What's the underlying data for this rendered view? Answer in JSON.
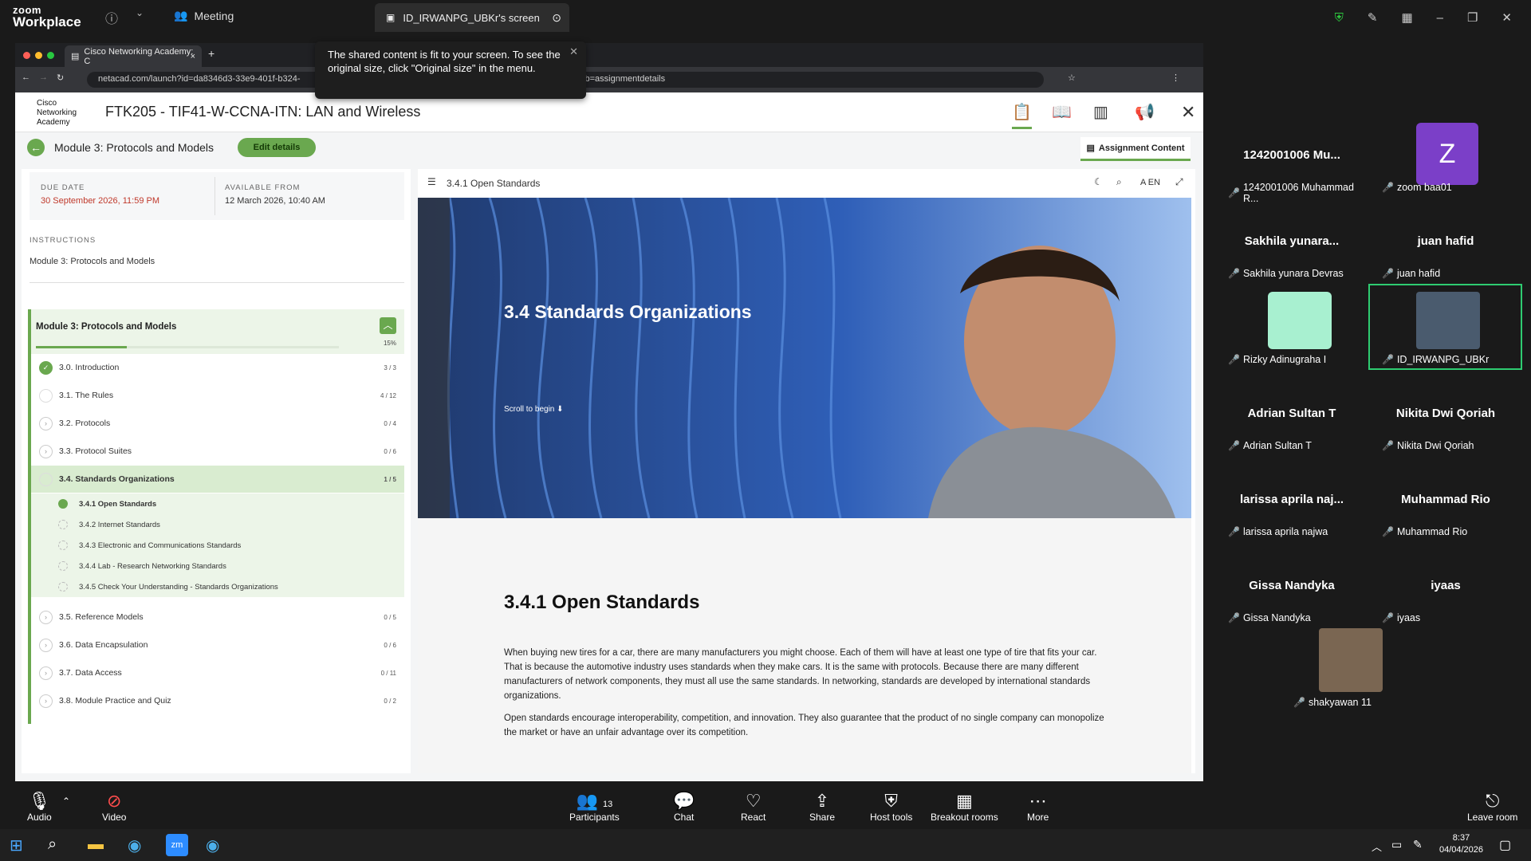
{
  "zoom": {
    "logo_line1": "zoom",
    "logo_line2": "Workplace",
    "meeting_label": "Meeting",
    "screen_tab_label": "ID_IRWANPG_UBKr's screen"
  },
  "toast": {
    "message": "The shared content is fit to your screen. To see the original size, click \"Original size\" in the menu."
  },
  "browser": {
    "tab_title": "Cisco Networking Academy: C",
    "url_left": "netacad.com/launch?id=da8346d3-33e9-401f-b324-",
    "url_right": "8-0dd8e67eee16&activeTab=assignmentdetails"
  },
  "app": {
    "logo_text": "Cisco Networking Academy",
    "course_title": "FTK205 - TIF41-W-CCNA-ITN: LAN and Wireless",
    "module_title": "Module 3: Protocols and Models",
    "edit_button": "Edit details",
    "assignment_tab": "Assignment Content"
  },
  "details": {
    "due_label": "DUE DATE",
    "due_value": "30 September 2026, 11:59 PM",
    "available_label": "AVAILABLE FROM",
    "available_value": "12 March 2026, 10:40 AM",
    "instructions_label": "INSTRUCTIONS",
    "instructions_value": "Module 3: Protocols and Models"
  },
  "module": {
    "title": "Module 3: Protocols and Models",
    "progress_text": "15%",
    "progress": 0.15,
    "items": [
      {
        "label": "3.0. Introduction",
        "count": "3 / 3"
      },
      {
        "label": "3.1. The Rules",
        "count": "4 / 12"
      },
      {
        "label": "3.2. Protocols",
        "count": "0 / 4"
      },
      {
        "label": "3.3. Protocol Suites",
        "count": "0 / 6"
      },
      {
        "label": "3.4. Standards Organizations",
        "count": "1 / 5"
      }
    ],
    "subitems": [
      "3.4.1 Open Standards",
      "3.4.2 Internet Standards",
      "3.4.3 Electronic and Communications Standards",
      "3.4.4 Lab - Research Networking Standards",
      "3.4.5 Check Your Understanding - Standards Organizations"
    ],
    "items_after": [
      {
        "label": "3.5. Reference Models",
        "count": "0 / 5"
      },
      {
        "label": "3.6. Data Encapsulation",
        "count": "0 / 6"
      },
      {
        "label": "3.7. Data Access",
        "count": "0 / 11"
      },
      {
        "label": "3.8. Module Practice and Quiz",
        "count": "0 / 2"
      }
    ]
  },
  "content": {
    "breadcrumb": "3.4.1 Open Standards",
    "lang": "EN",
    "hero_title": "3.4 Standards Organizations",
    "scroll_text": "Scroll to begin",
    "section_title": "3.4.1 Open Standards",
    "para1": "When buying new tires for a car, there are many manufacturers you might choose. Each of them will have at least one type of tire that fits your car. That is because the automotive industry uses standards when they make cars. It is the same with protocols. Because there are many different manufacturers of network components, they must all use the same standards. In networking, standards are developed by international standards organizations.",
    "para2": "Open standards encourage interoperability, competition, and innovation. They also guarantee that the product of no single company can monopolize the market or have an unfair advantage over its competition."
  },
  "participants": [
    {
      "name": "1242001006 Mu...",
      "label": "1242001006 Muhammad R..."
    },
    {
      "name": "Z",
      "label": "zoom baa01"
    },
    {
      "name": "Sakhila yunara...",
      "label": "Sakhila yunara Devras"
    },
    {
      "name": "juan hafid",
      "label": "juan hafid"
    },
    {
      "name": "",
      "label": "Rizky Adinugraha I"
    },
    {
      "name": "",
      "label": "ID_IRWANPG_UBKr"
    },
    {
      "name": "Adrian Sultan T",
      "label": "Adrian Sultan T"
    },
    {
      "name": "Nikita Dwi Qoriah",
      "label": "Nikita Dwi Qoriah"
    },
    {
      "name": "larissa aprila naj...",
      "label": "larissa aprila najwa"
    },
    {
      "name": "Muhammad Rio",
      "label": "Muhammad Rio"
    },
    {
      "name": "Gissa Nandyka",
      "label": "Gissa Nandyka"
    },
    {
      "name": "iyaas",
      "label": "iyaas"
    },
    {
      "name": "",
      "label": "shakyawan 11"
    }
  ],
  "controls": {
    "audio": "Audio",
    "video": "Video",
    "participants": "Participants",
    "participants_count": "13",
    "chat": "Chat",
    "react": "React",
    "share": "Share",
    "host_tools": "Host tools",
    "breakout": "Breakout rooms",
    "more": "More",
    "leave": "Leave room"
  },
  "taskbar": {
    "time": "8:37",
    "date": "04/04/2026"
  },
  "colors": {
    "accent_green": "#6aa84f",
    "due_red": "#c0392b",
    "zoom_bg": "#1a1a1a"
  }
}
